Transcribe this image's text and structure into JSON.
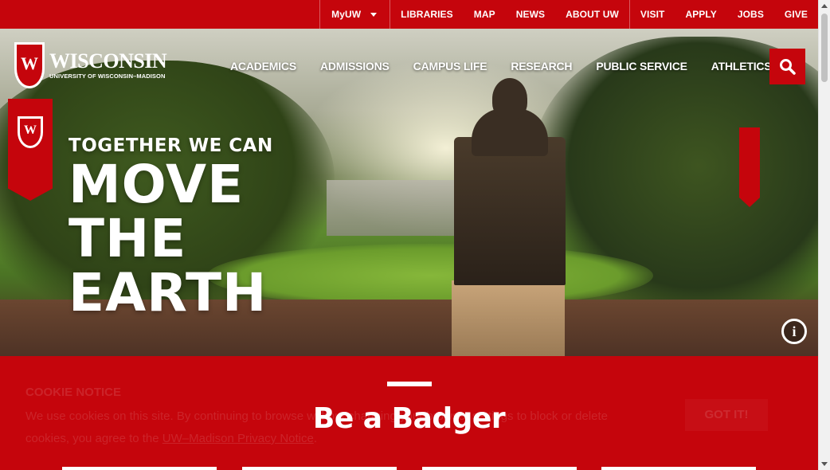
{
  "topbar": {
    "myuw": "MyUW",
    "links": [
      "LIBRARIES",
      "MAP",
      "NEWS",
      "ABOUT UW",
      "VISIT",
      "APPLY",
      "JOBS",
      "GIVE"
    ]
  },
  "logo": {
    "crest_letter": "W",
    "wordmark": "WISCONSIN",
    "subline": "UNIVERSITY OF WISCONSIN–MADISON"
  },
  "nav": [
    "ACADEMICS",
    "ADMISSIONS",
    "CAMPUS LIFE",
    "RESEARCH",
    "PUBLIC SERVICE",
    "ATHLETICS"
  ],
  "hero": {
    "tagline": "TOGETHER WE CAN",
    "line1": "MOVE",
    "line2": "THE",
    "line3": "EARTH",
    "banner_letter": "W",
    "info_glyph": "i"
  },
  "section": {
    "title": "Be a Badger"
  },
  "cookie": {
    "heading": "COOKIE NOTICE",
    "text_before": "We use cookies on this site. By continuing to browse without changing your browser settings to block or delete cookies, you agree to the ",
    "link": "UW–Madison Privacy Notice",
    "text_after": ".",
    "button": "GOT IT!"
  },
  "colors": {
    "brand_red": "#c5050c",
    "white": "#ffffff"
  }
}
